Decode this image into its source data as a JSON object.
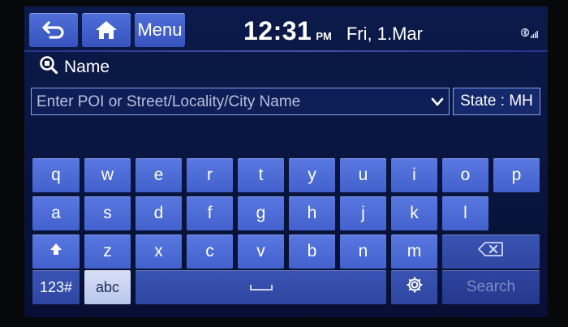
{
  "header": {
    "back_icon": "back-arrow-icon",
    "home_icon": "home-icon",
    "menu_label": "Menu",
    "time": "12:31",
    "ampm": "PM",
    "date": "Fri, 1.Mar",
    "status_icons": [
      "bluetooth-phone-icon",
      "signal-bars-icon"
    ]
  },
  "title": {
    "icon": "search-icon",
    "text": "Name"
  },
  "search": {
    "placeholder": "Enter POI or Street/Locality/City Name",
    "value": "",
    "dropdown_icon": "chevron-down-icon",
    "state_label": "State : MH"
  },
  "keyboard": {
    "row1": [
      "q",
      "w",
      "e",
      "r",
      "t",
      "y",
      "u",
      "i",
      "o",
      "p"
    ],
    "row2": [
      "a",
      "s",
      "d",
      "f",
      "g",
      "h",
      "j",
      "k",
      "l"
    ],
    "row3": [
      "z",
      "x",
      "c",
      "v",
      "b",
      "n",
      "m"
    ],
    "shift_icon": "shift-up-arrow-icon",
    "backspace_icon": "backspace-icon",
    "numeric_label": "123#",
    "abc_label": "abc",
    "space_icon": "space-bar-icon",
    "settings_icon": "gear-icon",
    "search_label": "Search"
  },
  "colors": {
    "key": "#4a69d6",
    "key_active": "#c9d3f2",
    "background": "#0b1a4a",
    "accent_border": "#8aa3f0"
  }
}
